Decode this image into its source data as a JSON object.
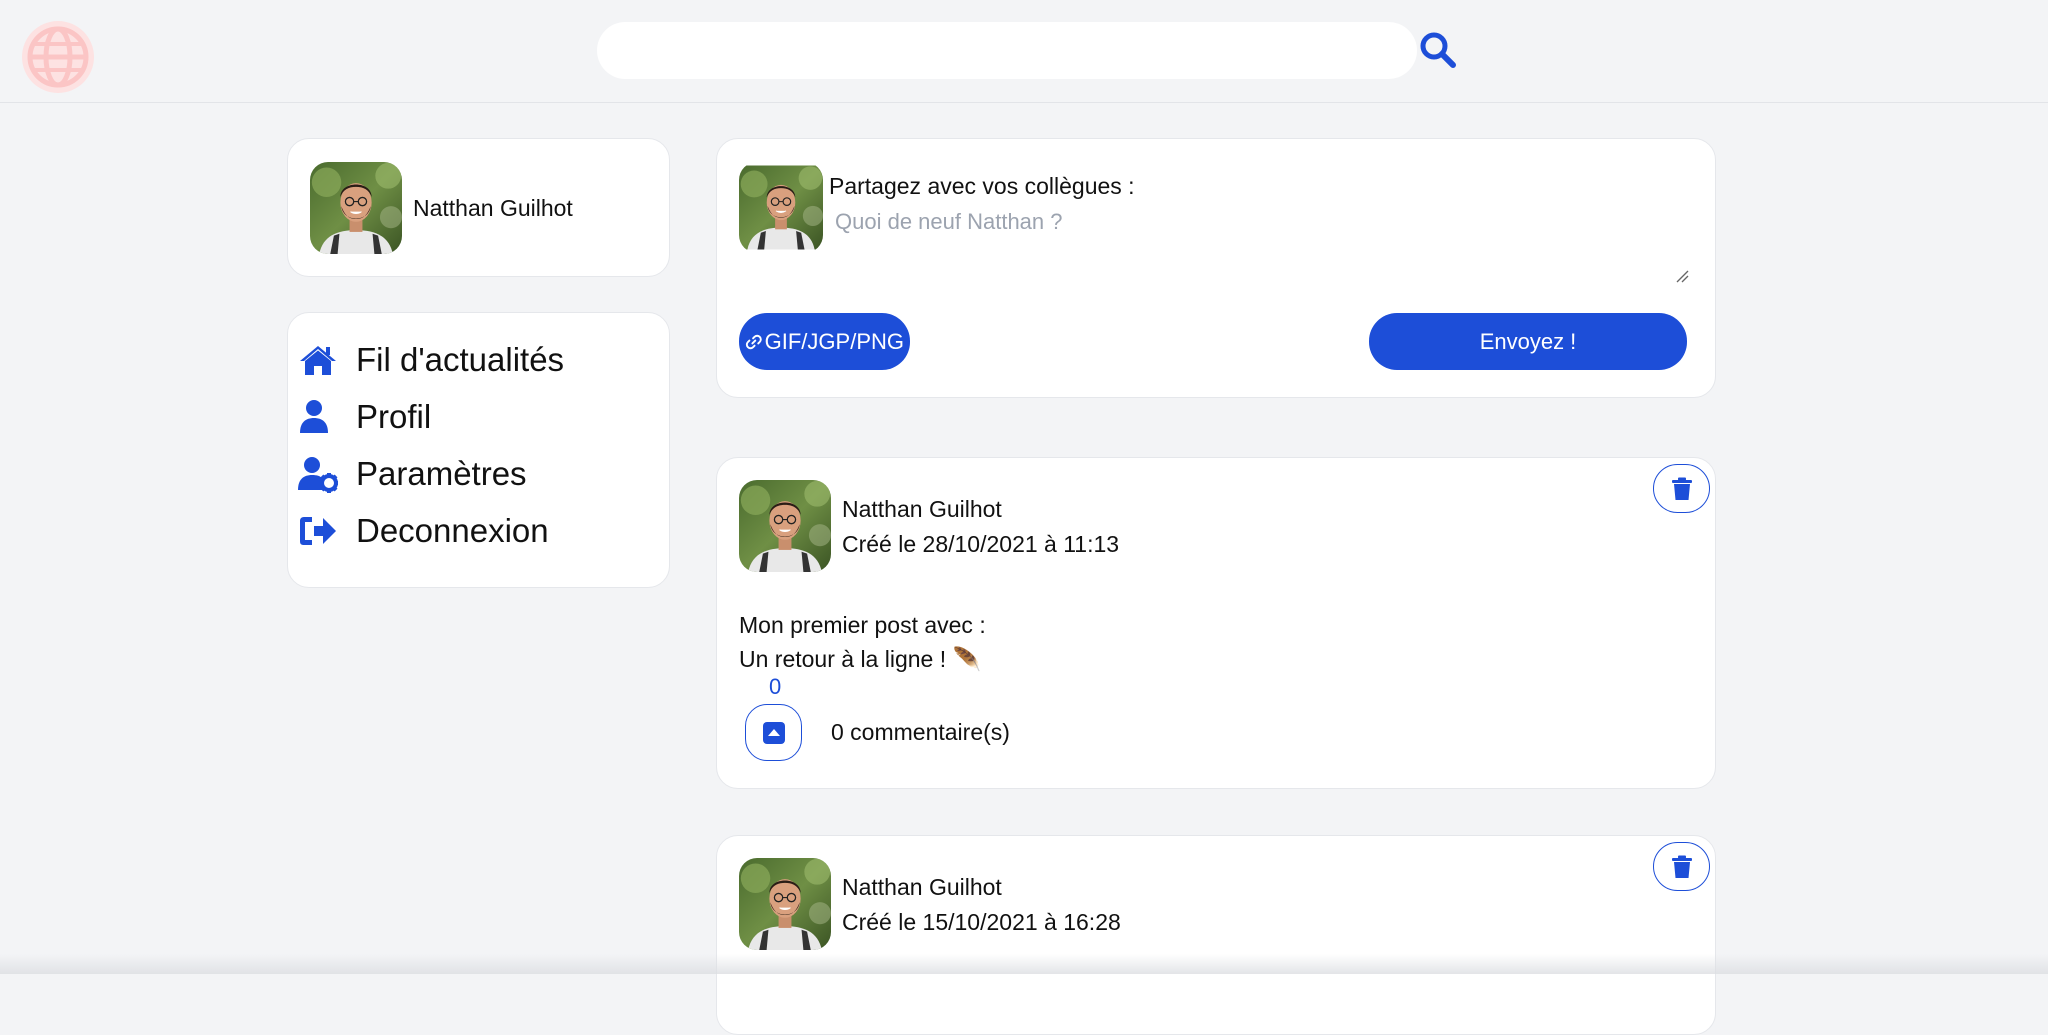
{
  "header": {
    "logo_icon": "globe-icon",
    "logo_color": "#fdd4d4",
    "search_value": "",
    "search_placeholder": "",
    "search_icon": "search-icon"
  },
  "user": {
    "name": "Natthan Guilhot",
    "avatar_icon": "avatar-photo"
  },
  "nav": {
    "items": [
      {
        "label": "Fil d'actualités",
        "icon": "home-icon"
      },
      {
        "label": "Profil",
        "icon": "user-icon"
      },
      {
        "label": "Paramètres",
        "icon": "user-gear-icon"
      },
      {
        "label": "Deconnexion",
        "icon": "logout-icon"
      }
    ]
  },
  "composer": {
    "label": "Partagez avec vos collègues :",
    "placeholder": "Quoi de neuf Natthan ?",
    "value": "",
    "attach_label": "GIF/JGP/PNG",
    "attach_icon": "link-icon",
    "send_label": "Envoyez !"
  },
  "posts": [
    {
      "author": "Natthan Guilhot",
      "date": "Créé le 28/10/2021 à 11:13",
      "text_line1": "Mon premier post avec :",
      "text_line2": "Un retour à la ligne ! 🪶",
      "likes": "0",
      "comments": "0 commentaire(s)"
    },
    {
      "author": "Natthan Guilhot",
      "date": "Créé le 15/10/2021 à 16:28"
    }
  ],
  "colors": {
    "accent": "#1d4ed8",
    "background": "#f3f4f6",
    "card": "#ffffff"
  }
}
